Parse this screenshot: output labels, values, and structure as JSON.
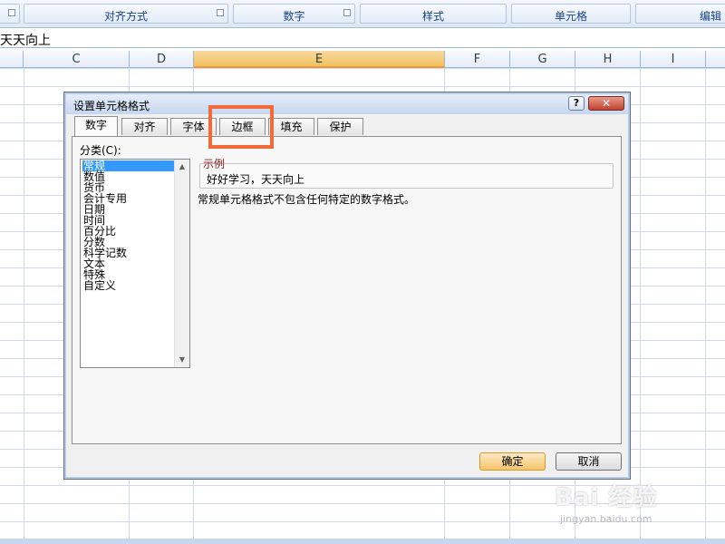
{
  "ribbon": {
    "groups": [
      "对齐方式",
      "数字",
      "样式",
      "单元格",
      "编辑"
    ]
  },
  "formula_bar": {
    "value": "天天向上"
  },
  "columns": [
    "C",
    "D",
    "E",
    "F",
    "G",
    "H",
    "I"
  ],
  "selected_column": "E",
  "dialog": {
    "title": "设置单元格格式",
    "help_label": "?",
    "close_label": "✕",
    "tabs": [
      "数字",
      "对齐",
      "字体",
      "边框",
      "填充",
      "保护"
    ],
    "active_tab": "数字",
    "category_label": "分类(C):",
    "categories": [
      "常规",
      "数值",
      "货币",
      "会计专用",
      "日期",
      "时间",
      "百分比",
      "分数",
      "科学记数",
      "文本",
      "特殊",
      "自定义"
    ],
    "selected_category": "常规",
    "sample_label": "示例",
    "sample_value": "好好学习，天天向上",
    "description": "常规单元格格式不包含任何特定的数字格式。",
    "ok_label": "确定",
    "cancel_label": "取消"
  },
  "watermark": {
    "brand": "Bai 经验",
    "url": "jingyan.baidu.com"
  },
  "colors": {
    "selected_col": "#f1c15f",
    "highlight": "#f26a3a",
    "list_selection": "#3399ff"
  }
}
